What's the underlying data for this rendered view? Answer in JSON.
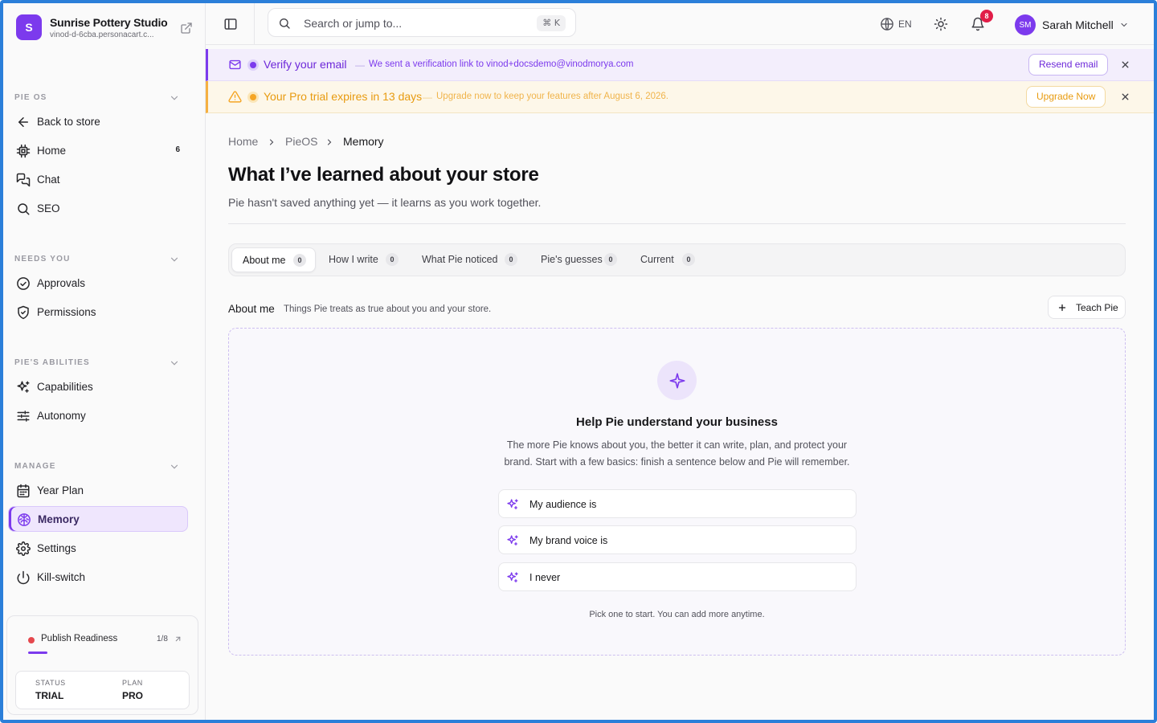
{
  "brand": {
    "logo_letter": "S",
    "name": "Sunrise Pottery Studio",
    "subdomain": "vinod-d-6cba.personacart.c...",
    "logo_color": "#7c3aed"
  },
  "sidebar": {
    "sections": [
      {
        "title": "PIE OS",
        "items": [
          {
            "label": "Back to store",
            "icon": "arrow-left-icon"
          },
          {
            "label": "Home",
            "icon": "chip-icon",
            "count": "6"
          },
          {
            "label": "Chat",
            "icon": "chat-bubbles-icon"
          },
          {
            "label": "SEO",
            "icon": "search-icon"
          }
        ]
      },
      {
        "title": "NEEDS YOU",
        "items": [
          {
            "label": "Approvals",
            "icon": "check-circle-icon"
          },
          {
            "label": "Permissions",
            "icon": "shield-check-icon"
          }
        ]
      },
      {
        "title": "PIE'S ABILITIES",
        "items": [
          {
            "label": "Capabilities",
            "icon": "sparkles-icon"
          },
          {
            "label": "Autonomy",
            "icon": "sliders-icon"
          }
        ]
      },
      {
        "title": "MANAGE",
        "items": [
          {
            "label": "Year Plan",
            "icon": "calendar-icon"
          },
          {
            "label": "Memory",
            "icon": "brain-icon",
            "active": true
          },
          {
            "label": "Settings",
            "icon": "gear-icon"
          },
          {
            "label": "Kill-switch",
            "icon": "power-icon"
          }
        ]
      }
    ],
    "publish": {
      "label": "Publish Readiness",
      "count": "1/8",
      "progress_fraction": 0.125,
      "status_key": "STATUS",
      "status_value": "TRIAL",
      "plan_key": "PLAN",
      "plan_value": "PRO"
    }
  },
  "topbar": {
    "search_placeholder": "Search or jump to...",
    "search_shortcut": "⌘ K",
    "language": "EN",
    "notification_count": "8",
    "user_initials": "SM",
    "user_name": "Sarah Mitchell"
  },
  "banners": {
    "verify": {
      "title": "Verify your email",
      "dash": "—",
      "message": "We sent a verification link to vinod+docsdemo@vinodmorya.com",
      "button": "Resend email",
      "accent": "#7c3aed"
    },
    "trial": {
      "title": "Your Pro trial expires in 13 days",
      "dash": "—",
      "message": "Upgrade now to keep your features after August 6, 2026.",
      "button": "Upgrade Now",
      "accent": "#f5a524"
    }
  },
  "main": {
    "breadcrumb": [
      "Home",
      "PieOS",
      "Memory"
    ],
    "title": "What I’ve learned about your store",
    "subtitle": "Pie hasn't saved anything yet — it learns as you work together.",
    "tabs": [
      {
        "label": "About me",
        "count": "0",
        "active": true
      },
      {
        "label": "How I write",
        "count": "0"
      },
      {
        "label": "What Pie noticed",
        "count": "0"
      },
      {
        "label": "Pie's guesses",
        "count": "0"
      },
      {
        "label": "Current",
        "count": "0"
      }
    ],
    "section": {
      "title": "About me",
      "description": "Things Pie treats as true about you and your store.",
      "teach_button": "Teach Pie"
    },
    "empty_state": {
      "title": "Help Pie understand your business",
      "description": "The more Pie knows about you, the better it can write, plan, and protect your brand. Start with a few basics: finish a sentence below and Pie will remember.",
      "prompts": [
        "My audience is",
        "My brand voice is",
        "I never"
      ],
      "hint": "Pick one to start. You can add more anytime."
    }
  }
}
